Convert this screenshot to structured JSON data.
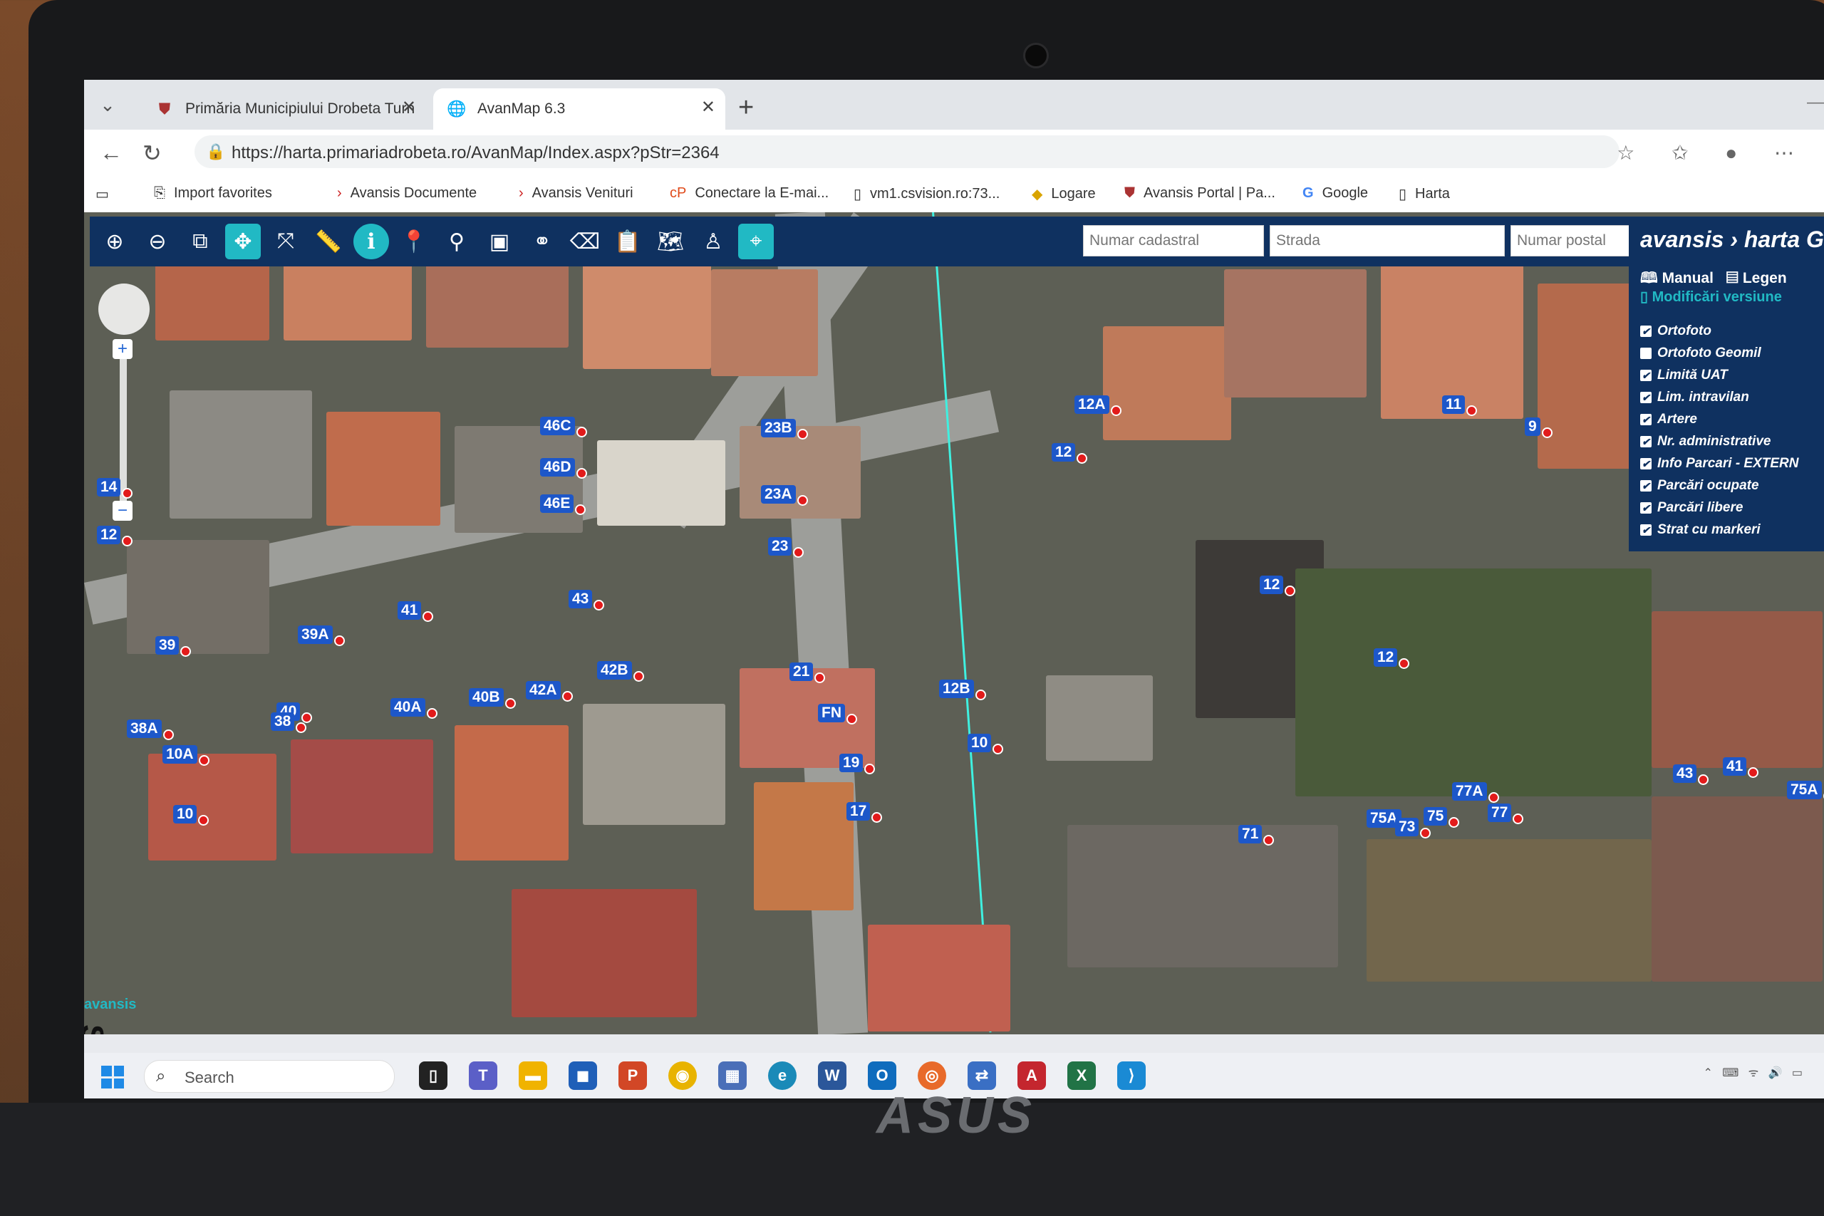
{
  "browser": {
    "tabs": [
      {
        "title": "Primăria Municipiului Drobeta Turn",
        "active": false
      },
      {
        "title": "AvanMap 6.3",
        "active": true
      }
    ],
    "url": "https://harta.primariadrobeta.ro/AvanMap/Index.aspx?pStr=2364",
    "bookmarks": [
      "Import favorites",
      "Avansis Documente",
      "Avansis Venituri",
      "Conectare la E-mai...",
      "vm1.csvision.ro:73...",
      "Logare",
      "Avansis Portal | Pa...",
      "Google",
      "Harta"
    ]
  },
  "map": {
    "search_fields": {
      "cadastral": "Numar cadastral",
      "street": "Strada",
      "postal": "Numar postal"
    },
    "brand": "avansis › harta GI",
    "panel_menu": {
      "manual": "Manual",
      "legend": "Legen",
      "changes": "Modificări versiune"
    },
    "layers": [
      {
        "name": "Ortofoto",
        "checked": true
      },
      {
        "name": "Ortofoto Geomil",
        "checked": false
      },
      {
        "name": "Limită UAT",
        "checked": true
      },
      {
        "name": "Lim. intravilan",
        "checked": true
      },
      {
        "name": "Artere",
        "checked": true
      },
      {
        "name": "Nr. administrative",
        "checked": true
      },
      {
        "name": "Info Parcari - EXTERN",
        "checked": true
      },
      {
        "name": "Parcări ocupate",
        "checked": true
      },
      {
        "name": "Parcări libere",
        "checked": true
      },
      {
        "name": "Strat cu markeri",
        "checked": true
      }
    ],
    "street_label": "Strada",
    "watermark": "avansis",
    "address_markers": [
      "46C",
      "23B",
      "46D",
      "23A",
      "46E",
      "23",
      "43",
      "41",
      "39A",
      "39",
      "14",
      "12",
      "12A",
      "12",
      "11",
      "9",
      "12",
      "12",
      "12B",
      "10",
      "21",
      "42B",
      "42A",
      "40B",
      "40A",
      "40",
      "38",
      "38A",
      "10A",
      "10",
      "FN",
      "19",
      "17",
      "75A",
      "73",
      "71",
      "77",
      "75",
      "77A",
      "75A",
      "41",
      "43"
    ]
  },
  "taskbar": {
    "search_placeholder": "Search"
  },
  "hardware": {
    "brand": "ASUS"
  }
}
